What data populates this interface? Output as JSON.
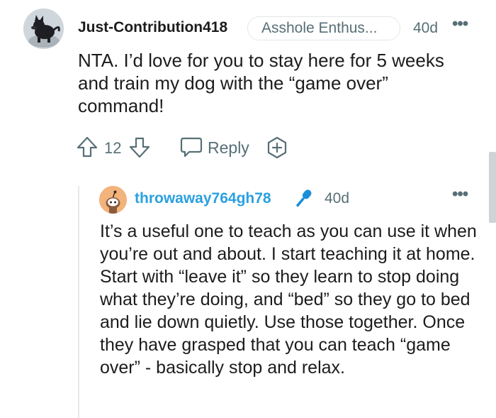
{
  "comment": {
    "username": "Just-Contribution418",
    "flair": "Asshole Enthus...",
    "age": "40d",
    "more": "•••",
    "body": "NTA. I’d love for you to stay here for 5 weeks and train my dog with the “game over” command!",
    "votes": "12",
    "reply_label": "Reply"
  },
  "reply": {
    "username": "throwaway764gh78",
    "age": "40d",
    "more": "•••",
    "body": "It’s a useful one to teach as you can use it when you’re out and about. I start teaching it at home. Start with “leave it” so they learn to stop doing what they’re doing, and “bed” so they go to bed and lie down quietly. Use those together. Once they have grasped that you can teach “game over” - basically stop and relax."
  },
  "colors": {
    "meta": "#576f76",
    "reply_username": "#2aa0e0",
    "mic": "#1a8fd8",
    "thread_line": "#e6e8ea"
  },
  "icons": [
    "dog-avatar",
    "upvote-icon",
    "downvote-icon",
    "reply-icon",
    "award-icon",
    "more-icon",
    "snoo-avatar",
    "microphone-icon"
  ]
}
